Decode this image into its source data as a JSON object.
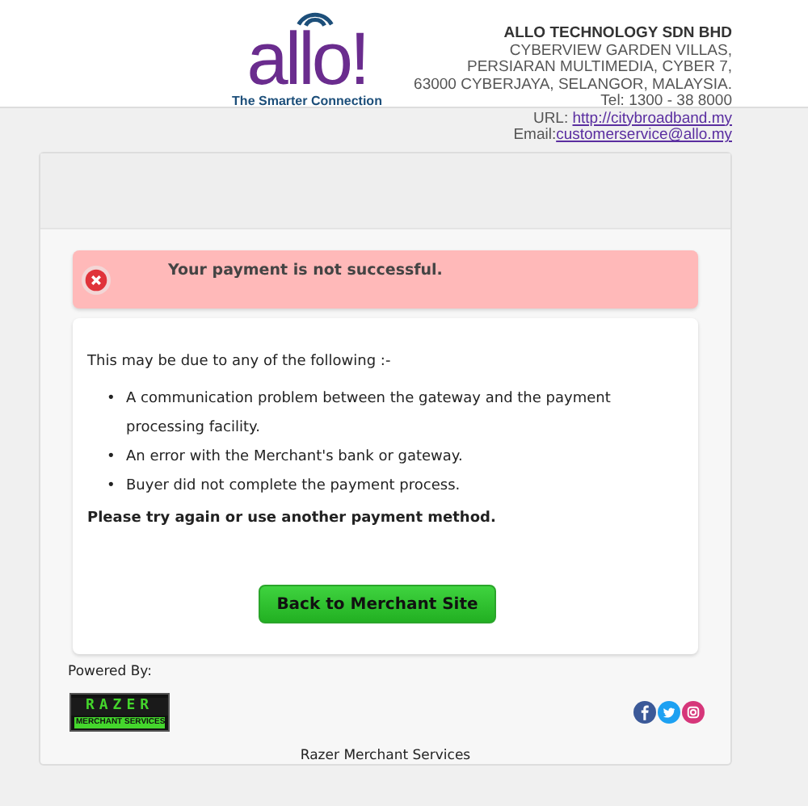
{
  "header": {
    "logo": {
      "word": "allo!",
      "tagline": "The Smarter Connection"
    },
    "company": "ALLO TECHNOLOGY SDN BHD",
    "address_lines": [
      "CYBERVIEW GARDEN VILLAS,",
      "PERSIARAN MULTIMEDIA, CYBER 7,",
      "63000 CYBERJAYA, SELANGOR, MALAYSIA.",
      "Tel: 1300 - 38 8000"
    ],
    "url_label": "URL: ",
    "url": "http://citybroadband.my",
    "email_label": "Email:",
    "email": "customerservice@allo.my"
  },
  "alert": {
    "kind": "error",
    "message": "Your payment is not successful."
  },
  "details": {
    "intro": "This may be due to any of the following :-",
    "bullet": "•",
    "reasons": [
      "A communication problem between the gateway and the payment processing facility.",
      "An error with the Merchant's bank or gateway.",
      "Buyer did not complete the payment process."
    ],
    "advice": "Please try again or use another payment method.",
    "button": "Back to Merchant Site"
  },
  "footer": {
    "powered_by": "Powered By:",
    "razer_logo": {
      "word": "RAZER",
      "sub": "MERCHANT SERVICES"
    },
    "caption": "Razer Merchant Services"
  }
}
